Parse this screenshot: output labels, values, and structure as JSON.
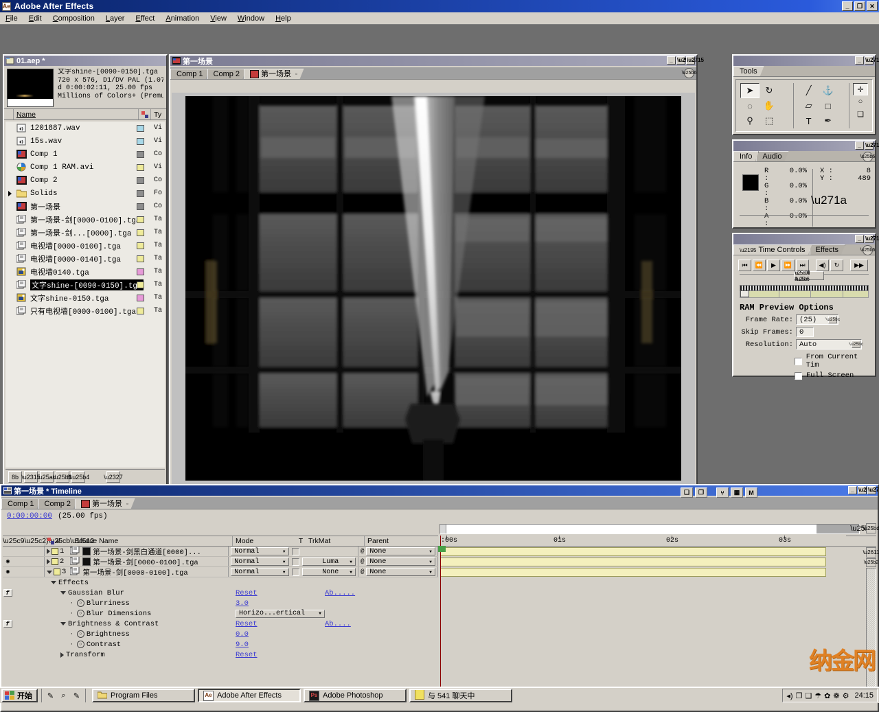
{
  "window": {
    "title": "Adobe After Effects",
    "minimize": "_",
    "restore": "❐",
    "close": "✕"
  },
  "menu": [
    "File",
    "Edit",
    "Composition",
    "Layer",
    "Effect",
    "Animation",
    "View",
    "Window",
    "Help"
  ],
  "project": {
    "title": "01.aep *",
    "meta": {
      "name": "文字shine-[0090-0150].tga",
      "line2": "720 x 576, D1/DV PAL (1.07)",
      "line3": "d 0:00:02:11, 25.00 fps",
      "line4": "Millions of Colors+ (Premul"
    },
    "columns": [
      "Name",
      "Ty"
    ],
    "items": [
      {
        "name": "1201887.wav",
        "type": "Vi",
        "swatch": "#a8d8e8",
        "icon": "audio-icon",
        "folder": false,
        "selected": false
      },
      {
        "name": "15s.wav",
        "type": "Vi",
        "swatch": "#a8d8e8",
        "icon": "audio-icon",
        "folder": false,
        "selected": false
      },
      {
        "name": "Comp 1",
        "type": "Co",
        "swatch": "#8e8e8e",
        "icon": "comp-icon",
        "folder": false,
        "selected": false
      },
      {
        "name": "Comp 1 RAM.avi",
        "type": "Vi",
        "swatch": "#efeb9a",
        "icon": "movie-icon",
        "folder": false,
        "selected": false
      },
      {
        "name": "Comp 2",
        "type": "Co",
        "swatch": "#8e8e8e",
        "icon": "comp-icon",
        "folder": false,
        "selected": false
      },
      {
        "name": "Solids",
        "type": "Fo",
        "swatch": "#8e8e8e",
        "icon": "folder-icon",
        "folder": true,
        "selected": false
      },
      {
        "name": "第一场景",
        "type": "Co",
        "swatch": "#8e8e8e",
        "icon": "comp-icon",
        "folder": false,
        "selected": false
      },
      {
        "name": "第一场景-剑[0000-0100].tga",
        "type": "Ta",
        "swatch": "#efeb9a",
        "icon": "sequence-icon",
        "folder": false,
        "selected": false
      },
      {
        "name": "第一场景-剑...[0000].tga",
        "type": "Ta",
        "swatch": "#efeb9a",
        "icon": "sequence-icon",
        "folder": false,
        "selected": false
      },
      {
        "name": "电视墙[0000-0100].tga",
        "type": "Ta",
        "swatch": "#efeb9a",
        "icon": "sequence-icon",
        "folder": false,
        "selected": false
      },
      {
        "name": "电视墙[0000-0140].tga",
        "type": "Ta",
        "swatch": "#efeb9a",
        "icon": "sequence-icon",
        "folder": false,
        "selected": false
      },
      {
        "name": "电视墙0140.tga",
        "type": "Ta",
        "swatch": "#e79ad8",
        "icon": "still-icon",
        "folder": false,
        "selected": false
      },
      {
        "name": "文字shine-[0090-0150].tga",
        "type": "Ta",
        "swatch": "#efeb9a",
        "icon": "sequence-icon",
        "folder": false,
        "selected": true
      },
      {
        "name": "文字shine-0150.tga",
        "type": "Ta",
        "swatch": "#e79ad8",
        "icon": "still-icon",
        "folder": false,
        "selected": false
      },
      {
        "name": "只有电视墙[0000-0100].tga",
        "type": "Ta",
        "swatch": "#efeb9a",
        "icon": "sequence-icon",
        "folder": false,
        "selected": false
      }
    ]
  },
  "comp": {
    "title": "第一场景",
    "tabs": [
      {
        "label": "Comp 1",
        "active": false
      },
      {
        "label": "Comp 2",
        "active": false
      },
      {
        "label": "第一场景",
        "active": true
      }
    ]
  },
  "tools": {
    "title": "Tools",
    "buttons": [
      {
        "name": "selection-tool",
        "glyph": "➤",
        "active": true
      },
      {
        "name": "rotation-tool",
        "glyph": "↻",
        "active": false
      },
      {
        "name": "orbit-camera-tool",
        "glyph": "◌",
        "active": false
      },
      {
        "name": "hand-tool",
        "glyph": "✋",
        "active": false
      },
      {
        "name": "zoom-tool",
        "glyph": "⚲",
        "active": false
      },
      {
        "name": "mask-tool",
        "glyph": "⬚",
        "active": false
      },
      {
        "name": "brush-tool",
        "glyph": "╱",
        "active": false
      },
      {
        "name": "clone-stamp-tool",
        "glyph": "⚓",
        "active": false
      },
      {
        "name": "eraser-tool",
        "glyph": "▱",
        "active": false
      },
      {
        "name": "shape-tool",
        "glyph": "□",
        "active": false
      },
      {
        "name": "text-tool",
        "glyph": "T",
        "active": false
      },
      {
        "name": "pen-tool",
        "glyph": "✒",
        "active": false
      },
      {
        "name": "axis-tool",
        "glyph": "✛",
        "active": true
      },
      {
        "name": "light-tool",
        "glyph": "○",
        "active": false
      },
      {
        "name": "snapshot-tool",
        "glyph": "❑",
        "active": false
      }
    ]
  },
  "info": {
    "tabs": [
      "Info",
      "Audio"
    ],
    "channels": [
      {
        "key": "R :",
        "value": "0.0%"
      },
      {
        "key": "G :",
        "value": "0.0%"
      },
      {
        "key": "B :",
        "value": "0.0%"
      },
      {
        "key": "A :",
        "value": "0.0%"
      }
    ],
    "coords": [
      {
        "key": "X :",
        "value": "8"
      },
      {
        "key": "Y :",
        "value": "489"
      }
    ],
    "color_swatch": "#000000"
  },
  "timecontrols": {
    "tabs": [
      "Time Controls",
      "Effects"
    ],
    "transport": [
      "⏮",
      "⏪",
      "▶",
      "⏩",
      "⏭"
    ],
    "audio_btn": "◀)",
    "loop_btn": "↻",
    "ram_btn": "▶▶",
    "section_title": "RAM Preview Options",
    "frame_rate_label": "Frame Rate:",
    "frame_rate_value": "(25)",
    "skip_frames_label": "Skip Frames:",
    "skip_frames_value": "0",
    "resolution_label": "Resolution:",
    "resolution_value": "Auto",
    "from_current_time": "From Current Tim",
    "full_screen": "Full Screen"
  },
  "timeline": {
    "title": "第一场景 * Timeline",
    "tabs": [
      {
        "label": "Comp 1",
        "active": false
      },
      {
        "label": "Comp 2",
        "active": false
      },
      {
        "label": "第一场景",
        "active": true
      }
    ],
    "current_time": "0:00:00:00",
    "fps": "(25.00 fps)",
    "switch_buttons": [
      "❑",
      "❐",
      "⑂",
      "▦",
      "M"
    ],
    "columns": {
      "av": [
        "◉",
        "◂)",
        "○",
        "ὑ2"
      ],
      "hash": "#",
      "source_name": "Source Name",
      "mode": "Mode",
      "t": "T",
      "trkmat": "TrkMat",
      "parent": "Parent"
    },
    "ruler_ticks": [
      ":00s",
      "01s",
      "02s",
      "03s"
    ],
    "layers": [
      {
        "index": "1",
        "name": "第一场景-剑黑白通道[0000]...",
        "mode": "Normal",
        "trkmat": "",
        "parent": "None",
        "visible": false,
        "expanded": false,
        "twirl": "closed",
        "has_icon": true
      },
      {
        "index": "2",
        "name": "第一场景-剑[0000-0100].tga",
        "mode": "Normal",
        "trkmat": "Luma",
        "parent": "None",
        "visible": true,
        "expanded": false,
        "twirl": "closed",
        "has_icon": true
      },
      {
        "index": "3",
        "name": "第一场景-剑[0000-0100].tga",
        "mode": "Normal",
        "trkmat": "None",
        "parent": "None",
        "visible": true,
        "expanded": true,
        "twirl": "open",
        "has_icon": false
      }
    ],
    "properties": [
      {
        "indent": 1,
        "twirl": "open",
        "label": "Effects",
        "value": "",
        "value2": "",
        "fx": false,
        "stopwatch": false,
        "link": false
      },
      {
        "indent": 2,
        "twirl": "open",
        "label": "Gaussian Blur",
        "value": "Reset",
        "value2": "Ab.....",
        "fx": true,
        "stopwatch": false,
        "link": true
      },
      {
        "indent": 3,
        "twirl": "none",
        "label": "Blurriness",
        "value": "3.0",
        "value2": "",
        "fx": false,
        "stopwatch": true,
        "link": true
      },
      {
        "indent": 3,
        "twirl": "none",
        "label": "Blur Dimensions",
        "value": "Horizo...ertical",
        "value2": "",
        "fx": false,
        "stopwatch": true,
        "link": false,
        "dropdown": true
      },
      {
        "indent": 2,
        "twirl": "open",
        "label": "Brightness & Contrast",
        "value": "Reset",
        "value2": "Ab....",
        "fx": true,
        "stopwatch": false,
        "link": true
      },
      {
        "indent": 3,
        "twirl": "none",
        "label": "Brightness",
        "value": "0.0",
        "value2": "",
        "fx": false,
        "stopwatch": true,
        "link": true
      },
      {
        "indent": 3,
        "twirl": "none",
        "label": "Contrast",
        "value": "9.0",
        "value2": "",
        "fx": false,
        "stopwatch": true,
        "link": true
      },
      {
        "indent": 2,
        "twirl": "closed",
        "label": "Transform",
        "value": "Reset",
        "value2": "",
        "fx": false,
        "stopwatch": false,
        "link": true
      }
    ]
  },
  "taskbar": {
    "start": "开始",
    "quick_launch": [
      "✎",
      "⌕",
      "✎"
    ],
    "tasks": [
      {
        "label": "Program Files",
        "icon": "folder-icon",
        "active": false
      },
      {
        "label": "Adobe After Effects",
        "icon": "ae-icon",
        "active": true
      },
      {
        "label": "Adobe Photoshop",
        "icon": "ps-icon",
        "active": false
      },
      {
        "label": "与 541 聊天中",
        "icon": "chat-icon",
        "active": false
      }
    ],
    "tray_icons": [
      "◂)",
      "❐",
      "❑",
      "☂",
      "✿",
      "❁",
      "⚙"
    ],
    "clock": "24:15"
  },
  "watermark": "纳金网"
}
